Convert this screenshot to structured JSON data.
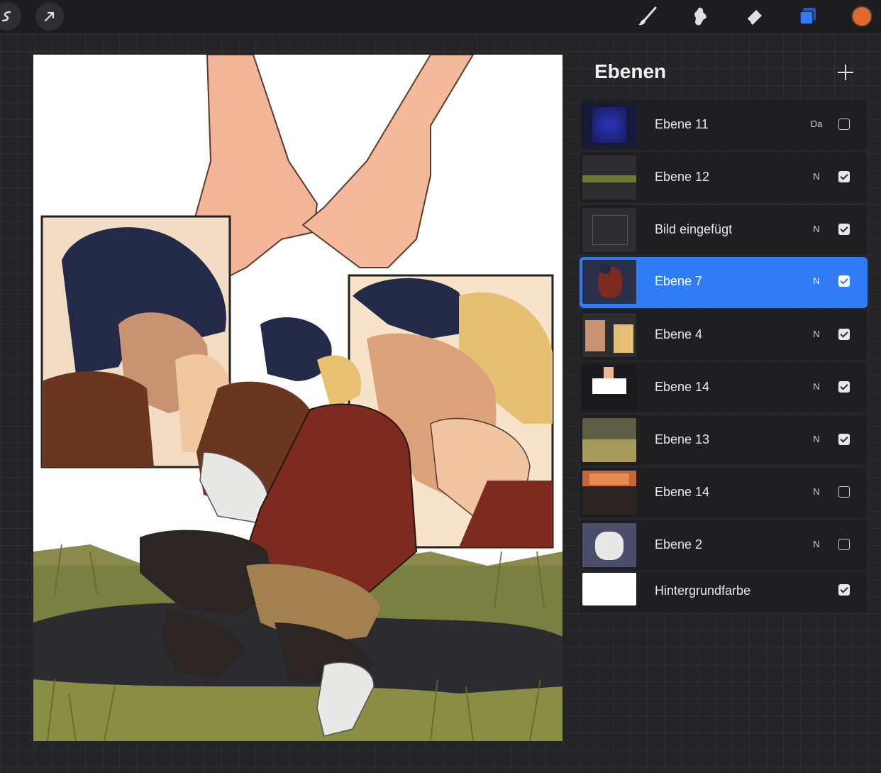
{
  "toolbar": {
    "left_icons": [
      "actions-icon",
      "transform-arrow-icon"
    ],
    "right_icons": [
      "brush-icon",
      "smudge-icon",
      "eraser-icon",
      "layers-icon"
    ],
    "active_color": "#e06a2e"
  },
  "canvas": {
    "description_icon": "artwork-canvas"
  },
  "layers_panel": {
    "title": "Ebenen",
    "add_icon": "plus-icon",
    "layers": [
      {
        "name": "Ebene 11",
        "blend": "Da",
        "visible": false,
        "selected": false
      },
      {
        "name": "Ebene 12",
        "blend": "N",
        "visible": true,
        "selected": false
      },
      {
        "name": "Bild eingefügt",
        "blend": "N",
        "visible": true,
        "selected": false
      },
      {
        "name": "Ebene 7",
        "blend": "N",
        "visible": true,
        "selected": true
      },
      {
        "name": "Ebene 4",
        "blend": "N",
        "visible": true,
        "selected": false
      },
      {
        "name": "Ebene 14",
        "blend": "N",
        "visible": true,
        "selected": false
      },
      {
        "name": "Ebene 13",
        "blend": "N",
        "visible": true,
        "selected": false
      },
      {
        "name": "Ebene 14",
        "blend": "N",
        "visible": false,
        "selected": false
      },
      {
        "name": "Ebene 2",
        "blend": "N",
        "visible": false,
        "selected": false
      },
      {
        "name": "Hintergrundfarbe",
        "blend": "",
        "visible": true,
        "selected": false
      }
    ]
  },
  "colors": {
    "accent": "#2f7cf6",
    "panel_bg": "#1f1f21"
  }
}
